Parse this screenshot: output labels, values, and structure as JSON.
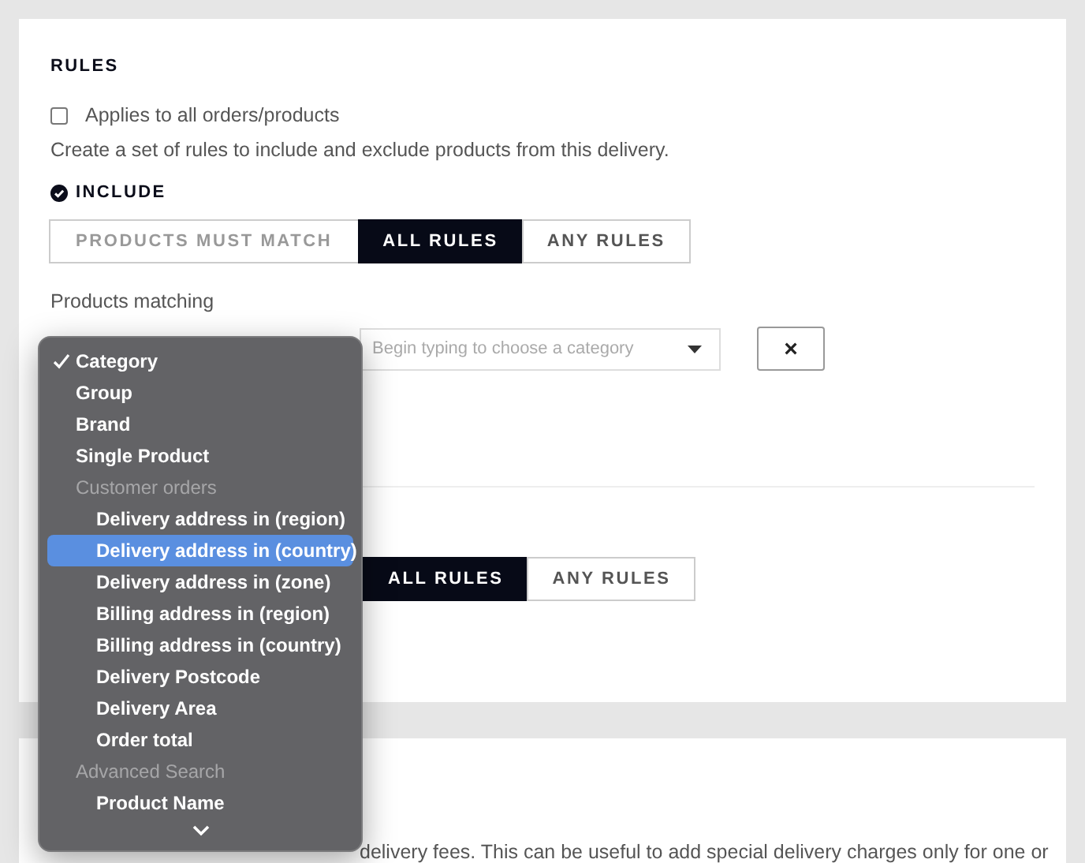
{
  "rules": {
    "title": "RULES",
    "applies_all": {
      "label": "Applies to all orders/products",
      "checked": false
    },
    "description": "Create a set of rules to include and exclude products from this delivery.",
    "include": {
      "title": "INCLUDE",
      "match_control": [
        {
          "label": "PRODUCTS MUST MATCH",
          "kind": "label",
          "selected": false
        },
        {
          "label": "ALL RULES",
          "kind": "option",
          "selected": true
        },
        {
          "label": "ANY RULES",
          "kind": "option",
          "selected": false
        }
      ],
      "products_matching_label": "Products matching",
      "category_field": {
        "placeholder": "Begin typing to choose a category"
      },
      "remove_button": "×"
    },
    "exclude": {
      "match_control": [
        {
          "label": "ALL RULES",
          "selected": true
        },
        {
          "label": "ANY RULES",
          "selected": false
        }
      ]
    }
  },
  "fees_section": {
    "text": "delivery fees. This can be useful to add special delivery charges only for one or"
  },
  "dropdown": {
    "options": [
      {
        "label": "Category",
        "kind": "option",
        "checked": true,
        "selected": false
      },
      {
        "label": "Group",
        "kind": "option",
        "checked": false,
        "selected": false
      },
      {
        "label": "Brand",
        "kind": "option",
        "checked": false,
        "selected": false
      },
      {
        "label": "Single Product",
        "kind": "option",
        "checked": false,
        "selected": false
      },
      {
        "label": "Customer orders",
        "kind": "group",
        "checked": false,
        "selected": false
      },
      {
        "label": "Delivery address in (region)",
        "kind": "suboption",
        "checked": false,
        "selected": false
      },
      {
        "label": "Delivery address in (country)",
        "kind": "suboption",
        "checked": false,
        "selected": true
      },
      {
        "label": "Delivery address in (zone)",
        "kind": "suboption",
        "checked": false,
        "selected": false
      },
      {
        "label": "Billing address in (region)",
        "kind": "suboption",
        "checked": false,
        "selected": false
      },
      {
        "label": "Billing address in (country)",
        "kind": "suboption",
        "checked": false,
        "selected": false
      },
      {
        "label": "Delivery Postcode",
        "kind": "suboption",
        "checked": false,
        "selected": false
      },
      {
        "label": "Delivery Area",
        "kind": "suboption",
        "checked": false,
        "selected": false
      },
      {
        "label": "Order total",
        "kind": "suboption",
        "checked": false,
        "selected": false
      },
      {
        "label": "Advanced Search",
        "kind": "group",
        "checked": false,
        "selected": false
      },
      {
        "label": "Product Name",
        "kind": "suboption",
        "checked": false,
        "selected": false
      }
    ]
  }
}
